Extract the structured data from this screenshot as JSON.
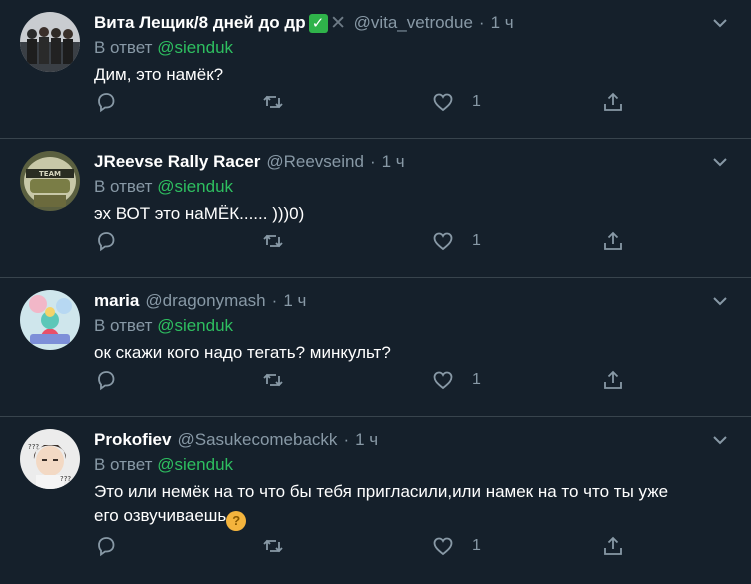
{
  "reply_prefix": "В ответ",
  "tweets": [
    {
      "name": "Вита Лещик/8 дней до др",
      "badges": [
        "✕",
        "✕"
      ],
      "handle": "@vita_vetrodue",
      "dot": "·",
      "time": "1 ч",
      "mention": "@sienduk",
      "text": "Дим, это намёк?",
      "likes": "1",
      "avatar": "group-photo"
    },
    {
      "name": "JReevse Rally Racer",
      "handle": "@Reevseind",
      "dot": "·",
      "time": "1 ч",
      "mention": "@sienduk",
      "text": "эх ВОТ это наМЁК...... )))0)",
      "likes": "1",
      "avatar": "helmet-photo"
    },
    {
      "name": "maria",
      "handle": "@dragonymash",
      "dot": "·",
      "time": "1 ч",
      "mention": "@sienduk",
      "text": "ок скажи кого надо тегать? минкульт?",
      "likes": "1",
      "avatar": "illustration"
    },
    {
      "name": "Prokofiev",
      "handle": "@Sasukecomebackk",
      "dot": "·",
      "time": "1 ч",
      "mention": "@sienduk",
      "text_line1": "Это или немёк на то что бы тебя пригласили,или намек на то что ты уже",
      "text_line2": "его озвучиваешь",
      "emoji": "thinking-face",
      "likes": "1",
      "avatar": "anime-character"
    }
  ],
  "colors": {
    "background": "#15202b",
    "divider": "#38444d",
    "secondary_text": "#8899a6",
    "mention": "#2ebf60"
  },
  "icons": {
    "reply": "reply-icon",
    "retweet": "retweet-icon",
    "like": "heart-icon",
    "share": "share-icon",
    "menu": "chevron-down-icon"
  }
}
